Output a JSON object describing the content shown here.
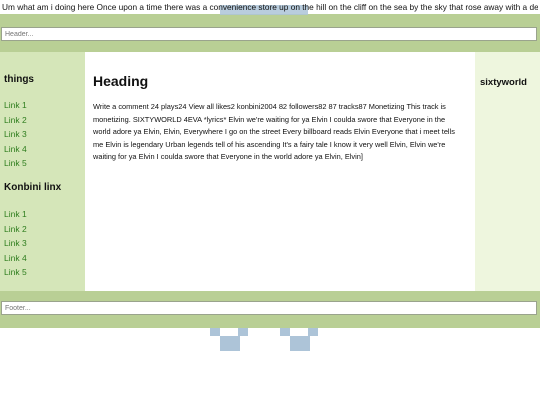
{
  "top_text": "Um what am i doing here Once upon a time there was a convenience store up on the hill on the cliff on the sea by the sky that rose away with a delivery service.",
  "header": {
    "placeholder": "Header..."
  },
  "footer": {
    "placeholder": "Footer..."
  },
  "left_sidebar": {
    "things_heading": "things",
    "things_links": [
      "Link 1",
      "Link 2",
      "Link 3",
      "Link 4",
      "Link 5"
    ],
    "konbini_heading": "Konbini linx",
    "konbini_links": [
      "Link 1",
      "Link 2",
      "Link 3",
      "Link 4",
      "Link 5"
    ]
  },
  "main": {
    "heading": "Heading",
    "body": "Write a comment 24 plays24 View all likes2 konbini2004 82 followers82 87 tracks87 Monetizing This track is monetizing. SIXTYWORLD 4EVA *lyrics* Elvin we're waiting for ya Elvin I coulda swore that Everyone in the world adore ya Elvin, Elvin, Everywhere I go on the street Every billboard reads Elvin Everyone that i meet tells me Elvin is legendary Urban legends tell of his ascending It's a fairy tale I know it very well Elvin, Elvin we're waiting for ya Elvin I coulda swore that Everyone in the world adore ya Elvin, Elvin]"
  },
  "right_sidebar": {
    "heading": "sixtyworld"
  },
  "colors": {
    "band_green": "#b9cf95",
    "left_sidebar": "#d5e6b9",
    "right_sidebar": "#eef6de",
    "link_green": "#2e7d1e",
    "pixel_blue": "#adc4d8"
  }
}
